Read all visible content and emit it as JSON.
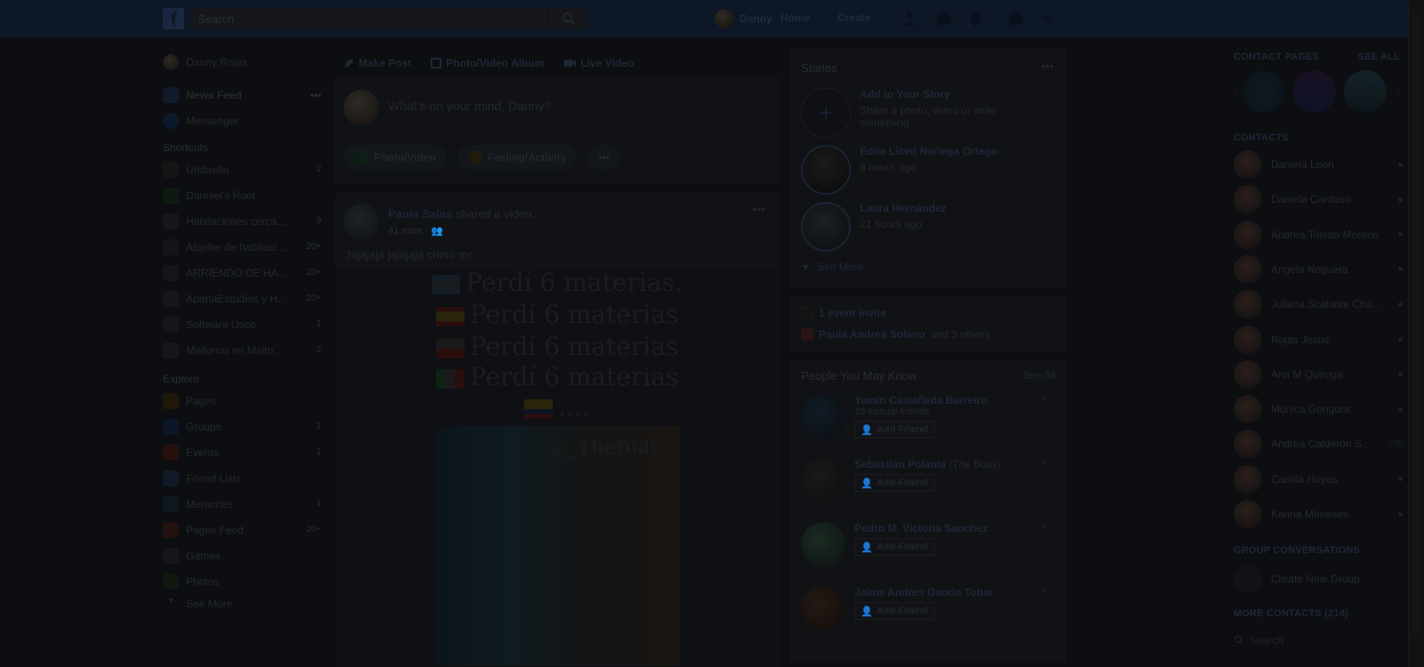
{
  "topbar": {
    "logo": "f",
    "search_placeholder": "Search",
    "user_name": "Danny",
    "nav_home": "Home",
    "nav_create": "Create",
    "icons": [
      "friend-requests-icon",
      "messenger-icon",
      "notifications-icon",
      "help-icon",
      "account-menu-icon"
    ]
  },
  "left": {
    "profile_name": "Danny Rojas",
    "news_feed": "News Feed",
    "messenger": "Messenger",
    "shortcuts_title": "Shortcuts",
    "shortcuts": [
      {
        "label": "Umbrella",
        "count": "2"
      },
      {
        "label": "Danniel's Root",
        "count": ""
      },
      {
        "label": "Habitaciones cerca...",
        "count": "9"
      },
      {
        "label": "Alquiler de habitaci...",
        "count": "20+"
      },
      {
        "label": "ARRIENDO DE HA...",
        "count": "20+"
      },
      {
        "label": "ApartaEstudios y H...",
        "count": "20+"
      },
      {
        "label": "Software Usco",
        "count": "1"
      },
      {
        "label": "Maitunos en Maito...",
        "count": "2"
      }
    ],
    "explore_title": "Explore",
    "explore": [
      {
        "label": "Pages",
        "count": ""
      },
      {
        "label": "Groups",
        "count": "1"
      },
      {
        "label": "Events",
        "count": "1"
      },
      {
        "label": "Friend Lists",
        "count": ""
      },
      {
        "label": "Memories",
        "count": "1"
      },
      {
        "label": "Pages Feed",
        "count": "20+"
      },
      {
        "label": "Games",
        "count": ""
      },
      {
        "label": "Photos",
        "count": ""
      }
    ],
    "see_more": "See More"
  },
  "composer": {
    "tab_make_post": "Make Post",
    "tab_photo_album": "Photo/Video Album",
    "tab_live_video": "Live Video",
    "placeholder": "What's on your mind, Danny?",
    "btn_photo": "Photo/Video",
    "btn_feeling": "Feeling/Activity",
    "btn_more": "•••"
  },
  "post": {
    "author": "Paula Salas",
    "action": "shared a video.",
    "time": "41 mins ·",
    "text": "Jajajaja jajajaja chino mc",
    "meme_lines": [
      "Perdí 6 materias.",
      "Perdí 6 materias",
      "Perdí 6 materias",
      "Perdí 6 materias"
    ],
    "last_line": "....",
    "watermark": "@_TheDidi"
  },
  "stories": {
    "title": "Stories",
    "add_title": "Add to Your Story",
    "add_sub": "Share a photo, video or write something",
    "items": [
      {
        "name": "Edna Liced Noriega Ortega",
        "time": "8 hours ago"
      },
      {
        "name": "Laura Hernández",
        "time": "21 hours ago"
      }
    ],
    "see_more": "See More"
  },
  "events": {
    "invite": "1 event invite",
    "from_name": "Paula Andrea Solano",
    "from_rest": "and 3 others"
  },
  "pymk": {
    "title": "People You May Know",
    "see_all": "See All",
    "add_label": "Add Friend",
    "people": [
      {
        "name": "Yamin Castañeda Barreiro",
        "sub": "18 mutual friends"
      },
      {
        "name": "Sebastián Polania",
        "sub": "(The Boss)"
      },
      {
        "name": "Pedro M. Victoria Sanchez",
        "sub": ""
      },
      {
        "name": "Jaime Andres Osorio Tobar",
        "sub": ""
      }
    ]
  },
  "sidebar": {
    "contact_pages": "CONTACT PAGES",
    "see_all": "SEE ALL",
    "contacts_title": "CONTACTS",
    "contacts": [
      {
        "name": "Daniela Leon",
        "status": ""
      },
      {
        "name": "Daniela Cardoso",
        "status": ""
      },
      {
        "name": "Andrea Toledo Moreno",
        "status": ""
      },
      {
        "name": "Angela Noguera",
        "status": ""
      },
      {
        "name": "Juliana Scalante Cha...",
        "status": ""
      },
      {
        "name": "Rojas Jesus",
        "status": ""
      },
      {
        "name": "Ana M Quiroga",
        "status": ""
      },
      {
        "name": "Mónica Góngora",
        "status": ""
      },
      {
        "name": "Andrea Calderón S...",
        "status": "17h"
      },
      {
        "name": "Camila Hoyos",
        "status": ""
      },
      {
        "name": "Karina Meneses",
        "status": ""
      }
    ],
    "group_conv": "GROUP CONVERSATIONS",
    "create_group": "Create New Group",
    "more_contacts": "MORE CONTACTS (214)",
    "search": "Search"
  }
}
